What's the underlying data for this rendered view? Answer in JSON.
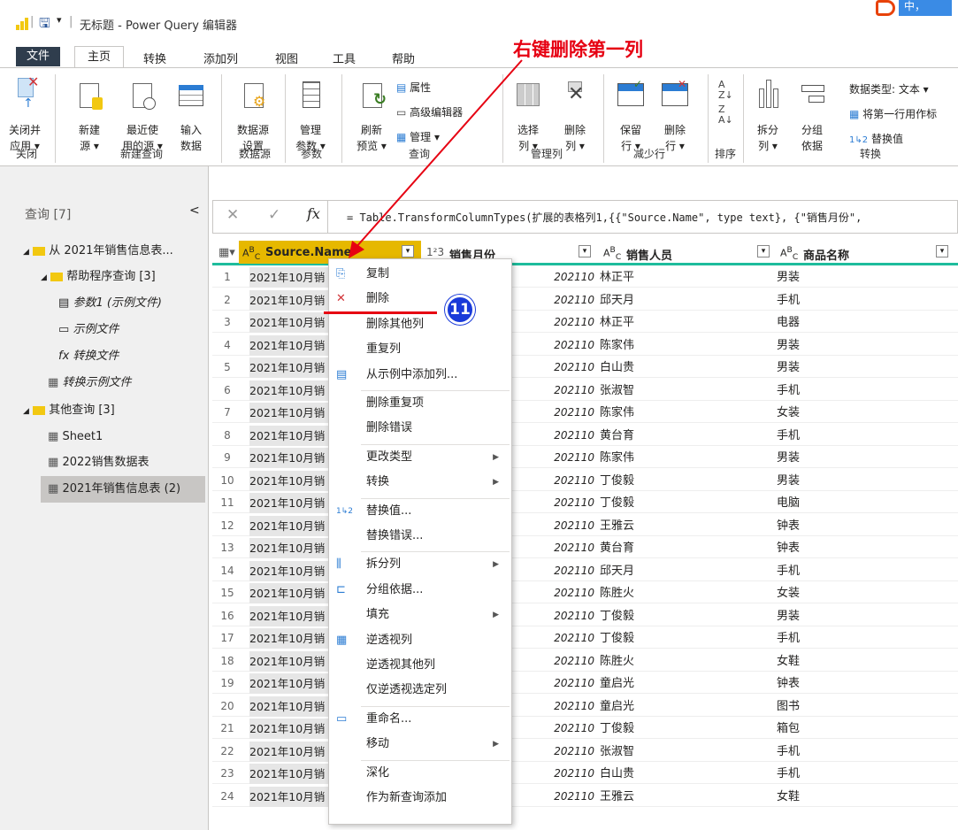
{
  "window": {
    "title": "无标题 - Power Query 编辑器"
  },
  "menu_tabs": [
    "文件",
    "主页",
    "转换",
    "添加列",
    "视图",
    "工具",
    "帮助"
  ],
  "ribbon": {
    "close_apply": [
      "关闭并",
      "应用 ▾"
    ],
    "new_source": [
      "新建",
      "源 ▾"
    ],
    "recent_sources": [
      "最近使",
      "用的源 ▾"
    ],
    "enter_data": [
      "输入",
      "数据"
    ],
    "data_source_settings": [
      "数据源",
      "设置"
    ],
    "manage_params": [
      "管理",
      "参数 ▾"
    ],
    "refresh_preview": [
      "刷新",
      "预览 ▾"
    ],
    "properties": "属性",
    "advanced_editor": "高级编辑器",
    "manage": "管理 ▾",
    "choose_cols": [
      "选择",
      "列 ▾"
    ],
    "remove_cols": [
      "删除",
      "列 ▾"
    ],
    "keep_rows": [
      "保留",
      "行 ▾"
    ],
    "remove_rows": [
      "删除",
      "行 ▾"
    ],
    "split_col": [
      "拆分",
      "列 ▾"
    ],
    "group_by": [
      "分组",
      "依据"
    ],
    "data_type": "数据类型: 文本 ▾",
    "first_row_header": "将第一行用作标",
    "replace_values": "替换值",
    "groups": [
      "关闭",
      "新建查询",
      "数据源",
      "参数",
      "查询",
      "管理列",
      "减少行",
      "排序",
      "转换"
    ]
  },
  "queries": {
    "header": "查询 [7]",
    "collapse": "<",
    "items": [
      {
        "label": "从 2021年销售信息表..."
      },
      {
        "label": "帮助程序查询 [3]"
      },
      {
        "label": "参数1 (示例文件)"
      },
      {
        "label": "示例文件"
      },
      {
        "label": "转换文件"
      },
      {
        "label": "转换示例文件"
      },
      {
        "label": "其他查询 [3]"
      },
      {
        "label": "Sheet1"
      },
      {
        "label": "2022销售数据表"
      },
      {
        "label": "2021年销售信息表 (2)"
      }
    ]
  },
  "formula": {
    "text": "= Table.TransformColumnTypes(扩展的表格列1,{{\"Source.Name\", type text}, {\"销售月份\","
  },
  "columns": [
    {
      "type": "A^B_C",
      "name": "Source.Name"
    },
    {
      "type": "1²3",
      "name": "销售月份"
    },
    {
      "type": "A^B_C",
      "name": "销售人员"
    },
    {
      "type": "A^B_C",
      "name": "商品名称"
    }
  ],
  "rows": [
    [
      "1",
      "2021年10月销",
      "202110",
      "林正平",
      "男装"
    ],
    [
      "2",
      "2021年10月销",
      "202110",
      "邱天月",
      "手机"
    ],
    [
      "3",
      "2021年10月销",
      "202110",
      "林正平",
      "电器"
    ],
    [
      "4",
      "2021年10月销",
      "202110",
      "陈家伟",
      "男装"
    ],
    [
      "5",
      "2021年10月销",
      "202110",
      "白山贵",
      "男装"
    ],
    [
      "6",
      "2021年10月销",
      "202110",
      "张淑智",
      "手机"
    ],
    [
      "7",
      "2021年10月销",
      "202110",
      "陈家伟",
      "女装"
    ],
    [
      "8",
      "2021年10月销",
      "202110",
      "黄台育",
      "手机"
    ],
    [
      "9",
      "2021年10月销",
      "202110",
      "陈家伟",
      "男装"
    ],
    [
      "10",
      "2021年10月销",
      "202110",
      "丁俊毅",
      "男装"
    ],
    [
      "11",
      "2021年10月销",
      "202110",
      "丁俊毅",
      "电脑"
    ],
    [
      "12",
      "2021年10月销",
      "202110",
      "王雅云",
      "钟表"
    ],
    [
      "13",
      "2021年10月销",
      "202110",
      "黄台育",
      "钟表"
    ],
    [
      "14",
      "2021年10月销",
      "202110",
      "邱天月",
      "手机"
    ],
    [
      "15",
      "2021年10月销",
      "202110",
      "陈胜火",
      "女装"
    ],
    [
      "16",
      "2021年10月销",
      "202110",
      "丁俊毅",
      "男装"
    ],
    [
      "17",
      "2021年10月销",
      "202110",
      "丁俊毅",
      "手机"
    ],
    [
      "18",
      "2021年10月销",
      "202110",
      "陈胜火",
      "女鞋"
    ],
    [
      "19",
      "2021年10月销",
      "202110",
      "童启光",
      "钟表"
    ],
    [
      "20",
      "2021年10月销",
      "202110",
      "童启光",
      "图书"
    ],
    [
      "21",
      "2021年10月销",
      "202110",
      "丁俊毅",
      "箱包"
    ],
    [
      "22",
      "2021年10月销",
      "202110",
      "张淑智",
      "手机"
    ],
    [
      "23",
      "2021年10月销",
      "202110",
      "白山贵",
      "手机"
    ],
    [
      "24",
      "2021年10月销",
      "202110",
      "王雅云",
      "女鞋"
    ]
  ],
  "context_menu": [
    {
      "label": "复制"
    },
    {
      "label": "删除"
    },
    {
      "label": "删除其他列"
    },
    {
      "label": "重复列"
    },
    {
      "label": "从示例中添加列..."
    },
    {
      "label": "删除重复项"
    },
    {
      "label": "删除错误"
    },
    {
      "label": "更改类型",
      "sub": true
    },
    {
      "label": "转换",
      "sub": true
    },
    {
      "label": "替换值..."
    },
    {
      "label": "替换错误..."
    },
    {
      "label": "拆分列",
      "sub": true
    },
    {
      "label": "分组依据..."
    },
    {
      "label": "填充",
      "sub": true
    },
    {
      "label": "逆透视列"
    },
    {
      "label": "逆透视其他列"
    },
    {
      "label": "仅逆透视选定列"
    },
    {
      "label": "重命名..."
    },
    {
      "label": "移动",
      "sub": true
    },
    {
      "label": "深化"
    },
    {
      "label": "作为新查询添加"
    }
  ],
  "annotation": {
    "text": "右键删除第一列",
    "badge": "11",
    "color": "#e60012"
  }
}
